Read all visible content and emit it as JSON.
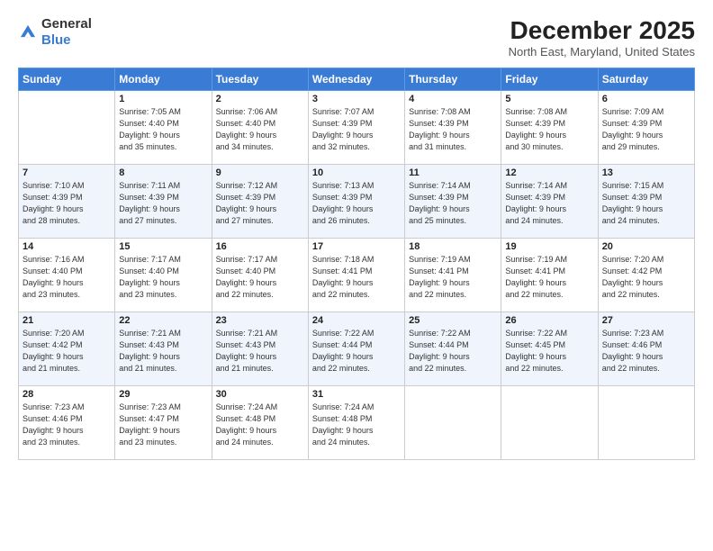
{
  "header": {
    "logo_general": "General",
    "logo_blue": "Blue",
    "title": "December 2025",
    "subtitle": "North East, Maryland, United States"
  },
  "calendar": {
    "weekdays": [
      "Sunday",
      "Monday",
      "Tuesday",
      "Wednesday",
      "Thursday",
      "Friday",
      "Saturday"
    ],
    "weeks": [
      [
        {
          "day": "",
          "info": ""
        },
        {
          "day": "1",
          "info": "Sunrise: 7:05 AM\nSunset: 4:40 PM\nDaylight: 9 hours\nand 35 minutes."
        },
        {
          "day": "2",
          "info": "Sunrise: 7:06 AM\nSunset: 4:40 PM\nDaylight: 9 hours\nand 34 minutes."
        },
        {
          "day": "3",
          "info": "Sunrise: 7:07 AM\nSunset: 4:39 PM\nDaylight: 9 hours\nand 32 minutes."
        },
        {
          "day": "4",
          "info": "Sunrise: 7:08 AM\nSunset: 4:39 PM\nDaylight: 9 hours\nand 31 minutes."
        },
        {
          "day": "5",
          "info": "Sunrise: 7:08 AM\nSunset: 4:39 PM\nDaylight: 9 hours\nand 30 minutes."
        },
        {
          "day": "6",
          "info": "Sunrise: 7:09 AM\nSunset: 4:39 PM\nDaylight: 9 hours\nand 29 minutes."
        }
      ],
      [
        {
          "day": "7",
          "info": "Sunrise: 7:10 AM\nSunset: 4:39 PM\nDaylight: 9 hours\nand 28 minutes."
        },
        {
          "day": "8",
          "info": "Sunrise: 7:11 AM\nSunset: 4:39 PM\nDaylight: 9 hours\nand 27 minutes."
        },
        {
          "day": "9",
          "info": "Sunrise: 7:12 AM\nSunset: 4:39 PM\nDaylight: 9 hours\nand 27 minutes."
        },
        {
          "day": "10",
          "info": "Sunrise: 7:13 AM\nSunset: 4:39 PM\nDaylight: 9 hours\nand 26 minutes."
        },
        {
          "day": "11",
          "info": "Sunrise: 7:14 AM\nSunset: 4:39 PM\nDaylight: 9 hours\nand 25 minutes."
        },
        {
          "day": "12",
          "info": "Sunrise: 7:14 AM\nSunset: 4:39 PM\nDaylight: 9 hours\nand 24 minutes."
        },
        {
          "day": "13",
          "info": "Sunrise: 7:15 AM\nSunset: 4:39 PM\nDaylight: 9 hours\nand 24 minutes."
        }
      ],
      [
        {
          "day": "14",
          "info": "Sunrise: 7:16 AM\nSunset: 4:40 PM\nDaylight: 9 hours\nand 23 minutes."
        },
        {
          "day": "15",
          "info": "Sunrise: 7:17 AM\nSunset: 4:40 PM\nDaylight: 9 hours\nand 23 minutes."
        },
        {
          "day": "16",
          "info": "Sunrise: 7:17 AM\nSunset: 4:40 PM\nDaylight: 9 hours\nand 22 minutes."
        },
        {
          "day": "17",
          "info": "Sunrise: 7:18 AM\nSunset: 4:41 PM\nDaylight: 9 hours\nand 22 minutes."
        },
        {
          "day": "18",
          "info": "Sunrise: 7:19 AM\nSunset: 4:41 PM\nDaylight: 9 hours\nand 22 minutes."
        },
        {
          "day": "19",
          "info": "Sunrise: 7:19 AM\nSunset: 4:41 PM\nDaylight: 9 hours\nand 22 minutes."
        },
        {
          "day": "20",
          "info": "Sunrise: 7:20 AM\nSunset: 4:42 PM\nDaylight: 9 hours\nand 22 minutes."
        }
      ],
      [
        {
          "day": "21",
          "info": "Sunrise: 7:20 AM\nSunset: 4:42 PM\nDaylight: 9 hours\nand 21 minutes."
        },
        {
          "day": "22",
          "info": "Sunrise: 7:21 AM\nSunset: 4:43 PM\nDaylight: 9 hours\nand 21 minutes."
        },
        {
          "day": "23",
          "info": "Sunrise: 7:21 AM\nSunset: 4:43 PM\nDaylight: 9 hours\nand 21 minutes."
        },
        {
          "day": "24",
          "info": "Sunrise: 7:22 AM\nSunset: 4:44 PM\nDaylight: 9 hours\nand 22 minutes."
        },
        {
          "day": "25",
          "info": "Sunrise: 7:22 AM\nSunset: 4:44 PM\nDaylight: 9 hours\nand 22 minutes."
        },
        {
          "day": "26",
          "info": "Sunrise: 7:22 AM\nSunset: 4:45 PM\nDaylight: 9 hours\nand 22 minutes."
        },
        {
          "day": "27",
          "info": "Sunrise: 7:23 AM\nSunset: 4:46 PM\nDaylight: 9 hours\nand 22 minutes."
        }
      ],
      [
        {
          "day": "28",
          "info": "Sunrise: 7:23 AM\nSunset: 4:46 PM\nDaylight: 9 hours\nand 23 minutes."
        },
        {
          "day": "29",
          "info": "Sunrise: 7:23 AM\nSunset: 4:47 PM\nDaylight: 9 hours\nand 23 minutes."
        },
        {
          "day": "30",
          "info": "Sunrise: 7:24 AM\nSunset: 4:48 PM\nDaylight: 9 hours\nand 24 minutes."
        },
        {
          "day": "31",
          "info": "Sunrise: 7:24 AM\nSunset: 4:48 PM\nDaylight: 9 hours\nand 24 minutes."
        },
        {
          "day": "",
          "info": ""
        },
        {
          "day": "",
          "info": ""
        },
        {
          "day": "",
          "info": ""
        }
      ]
    ]
  }
}
